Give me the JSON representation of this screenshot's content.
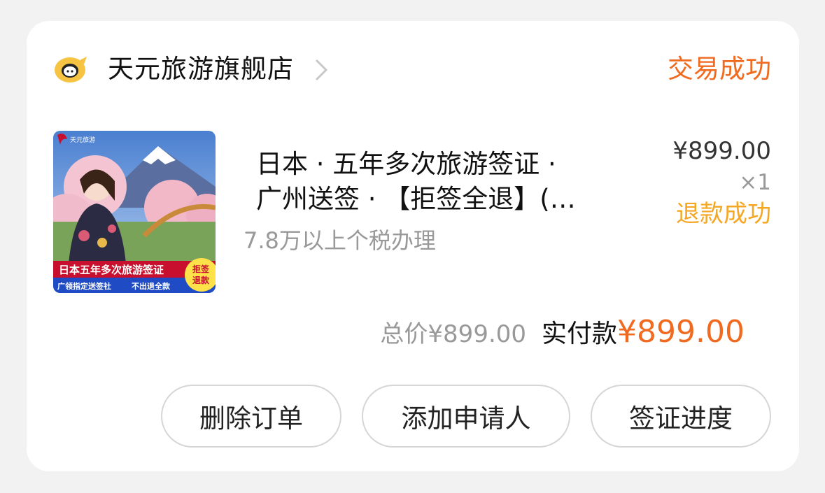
{
  "order": {
    "shop_name": "天元旅游旗舰店",
    "status": "交易成功",
    "product": {
      "title_line1": "日本 · 五年多次旅游签证 ·",
      "title_line2": "广州送签 · 【拒签全退】(…",
      "sku": "7.8万以上个税办理",
      "unit_price": "¥899.00",
      "quantity": "×1",
      "refund_status": "退款成功",
      "image": {
        "banner_text": "日本五年多次旅游签证",
        "subtext_left": "广领指定送签社",
        "subtext_right": "不出退全款",
        "badge_text_1": "拒签",
        "badge_text_2": "退款",
        "logo_text": "天元旅游"
      }
    },
    "total_label": "总价",
    "total_value": "¥899.00",
    "paid_label": "实付款",
    "paid_value": "¥899.00"
  },
  "actions": {
    "delete_label": "删除订单",
    "add_applicant_label": "添加申请人",
    "visa_progress_label": "签证进度"
  },
  "colors": {
    "accent": "#f06a20",
    "refund": "#f5a623",
    "muted": "#999999",
    "logo_yellow": "#f6c343"
  },
  "icons": {
    "shop_logo": "fliggy-logo-icon",
    "chevron": "chevron-right-icon"
  }
}
